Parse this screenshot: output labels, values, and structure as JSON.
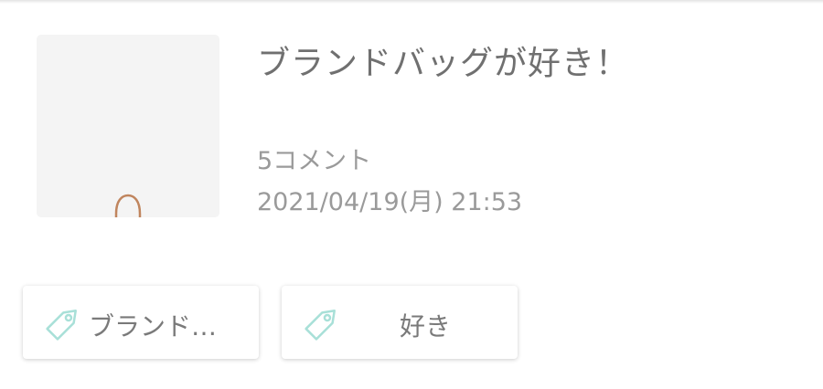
{
  "article": {
    "title": "ブランドバッグが好き！",
    "comments": "5コメント",
    "date": "2021/04/19(月) 21:53"
  },
  "tags": [
    {
      "label": "ブランド…",
      "icon": "tag-icon"
    },
    {
      "label": "好き",
      "icon": "tag-icon"
    }
  ],
  "colors": {
    "title_text": "#707070",
    "meta_text": "#9a9a9a",
    "tag_icon": "#a8e0d8",
    "thumbnail_bg": "#f4f4f4",
    "bag_handle": "#c0855e"
  }
}
